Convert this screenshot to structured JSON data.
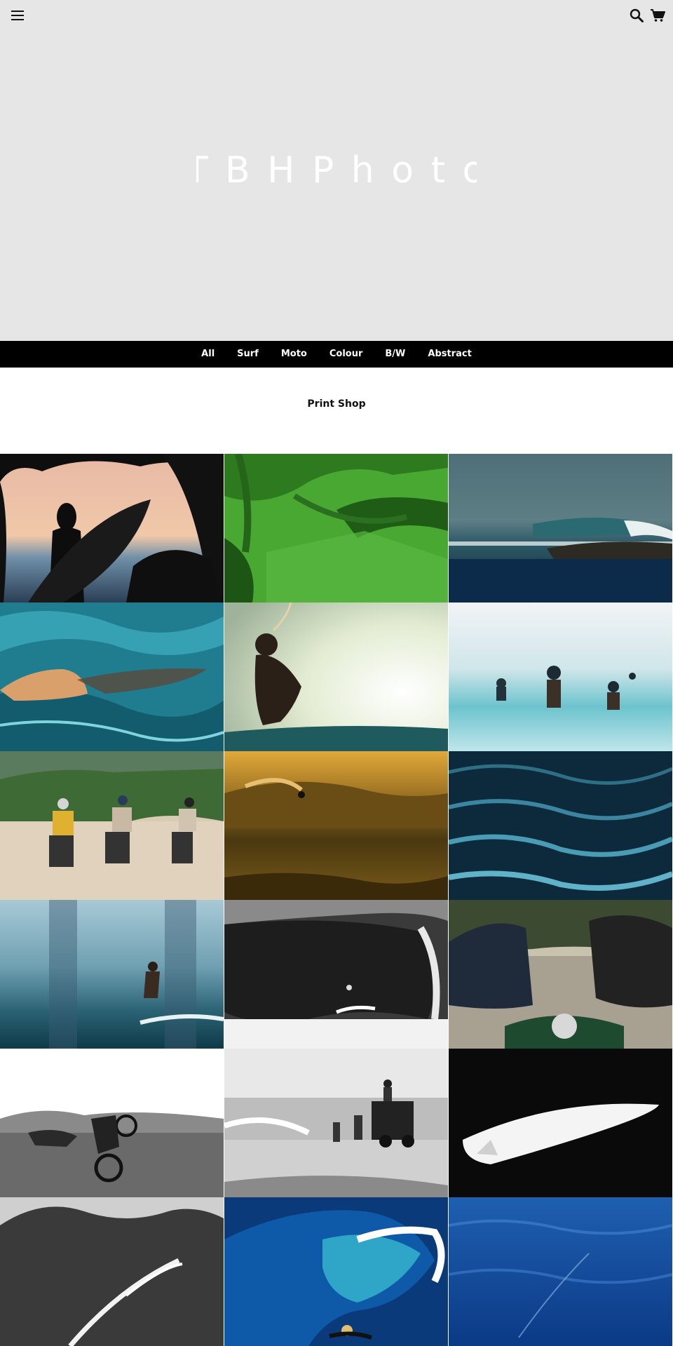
{
  "header": {
    "logo_text": "T B H  P h o t o",
    "menu_icon": "hamburger-menu-icon",
    "search_icon": "search-icon",
    "cart_icon": "cart-icon"
  },
  "nav": {
    "items": [
      {
        "label": "All"
      },
      {
        "label": "Surf"
      },
      {
        "label": "Moto"
      },
      {
        "label": "Colour"
      },
      {
        "label": "B/W"
      },
      {
        "label": "Abstract"
      }
    ]
  },
  "main": {
    "title": "Print Shop"
  },
  "colors": {
    "hero_bg": "#e6e6e6",
    "nav_bg": "#000000",
    "nav_text": "#ffffff"
  }
}
